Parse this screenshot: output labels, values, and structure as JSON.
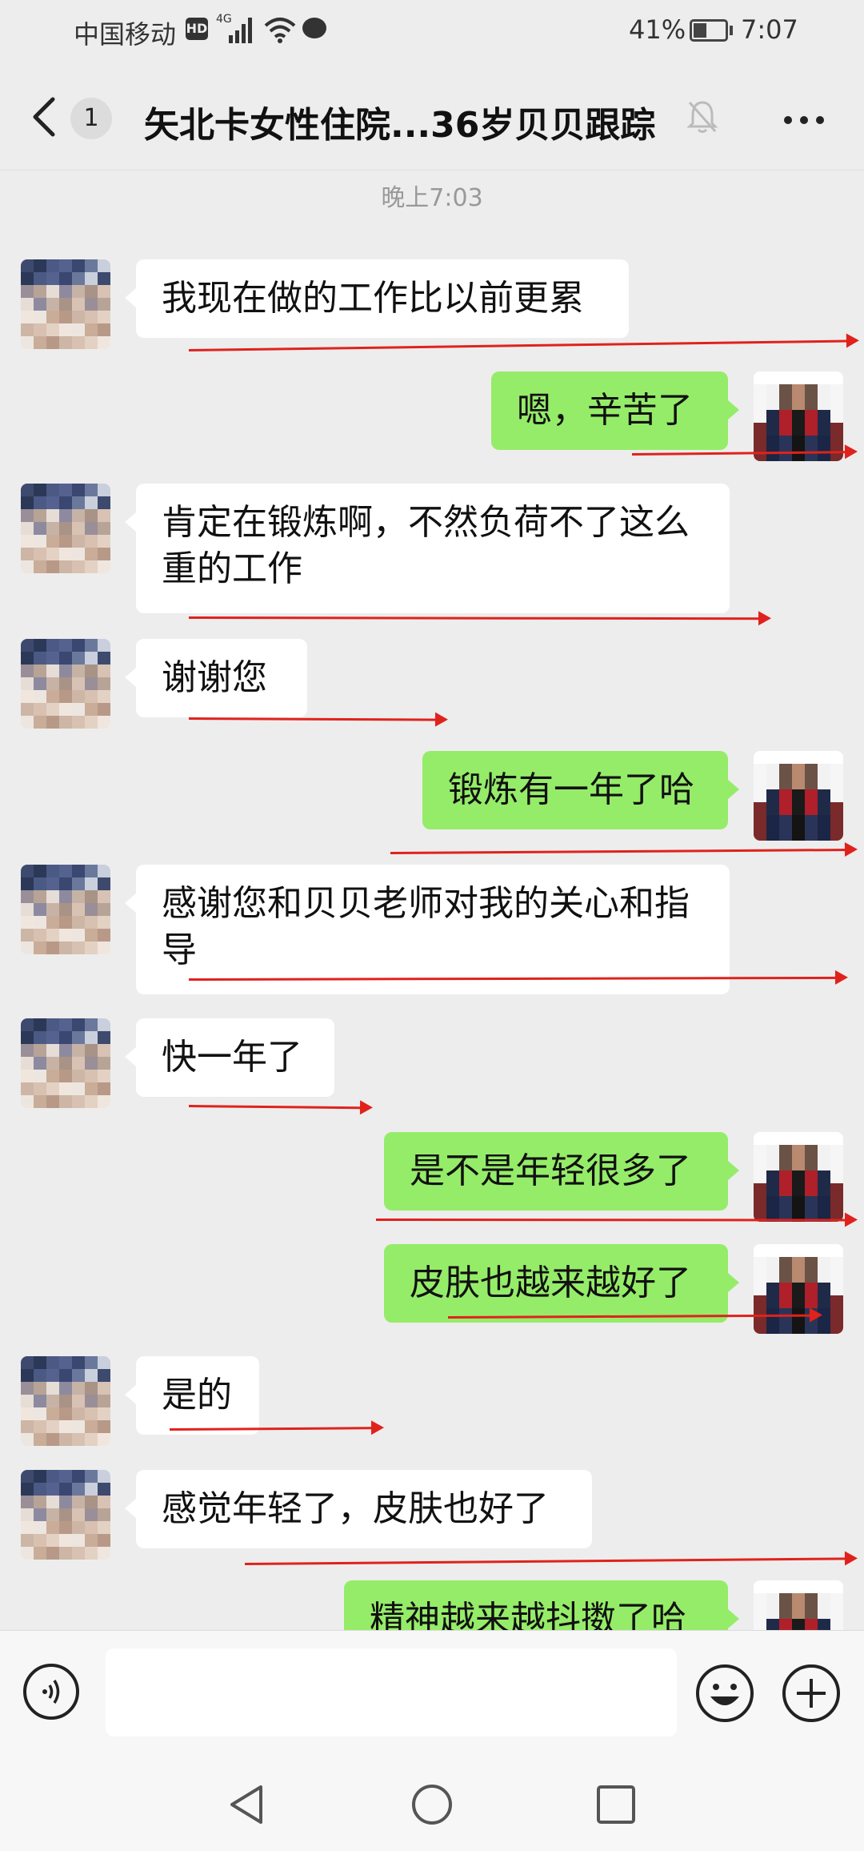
{
  "status": {
    "carrier": "中国移动",
    "hd": "HD",
    "network": "4G",
    "battery_pct": "41%",
    "battery_level": 0.41,
    "time": "7:07"
  },
  "nav": {
    "unread_count": "1",
    "title": "矢北卡女性住院...36岁贝贝跟踪"
  },
  "timestamp": "晚上7:03",
  "messages": [
    {
      "side": "in",
      "text": "我现在做的工作比以前更累"
    },
    {
      "side": "out",
      "text": "嗯，辛苦了"
    },
    {
      "side": "in",
      "text": "肯定在锻炼啊，不然负荷不了这么重的工作"
    },
    {
      "side": "in",
      "text": "谢谢您"
    },
    {
      "side": "out",
      "text": "锻炼有一年了哈"
    },
    {
      "side": "in",
      "text": "感谢您和贝贝老师对我的关心和指导"
    },
    {
      "side": "in",
      "text": "快一年了"
    },
    {
      "side": "out",
      "text": "是不是年轻很多了"
    },
    {
      "side": "out",
      "text": "皮肤也越来越好了"
    },
    {
      "side": "in",
      "text": "是的"
    },
    {
      "side": "in",
      "text": "感觉年轻了，皮肤也好了"
    },
    {
      "side": "out",
      "text": "精神越来越抖擞了哈"
    }
  ],
  "input": {
    "value": "",
    "placeholder": ""
  },
  "icons": {
    "back": "chevron-left-icon",
    "mute": "bell-off-icon",
    "more": "more-horizontal-icon",
    "voice": "voice-icon",
    "emoji": "emoji-icon",
    "plus": "plus-icon"
  },
  "colors": {
    "incoming_bubble": "#ffffff",
    "outgoing_bubble": "#95ec69",
    "background": "#ededed",
    "annotation": "#e0221c"
  }
}
